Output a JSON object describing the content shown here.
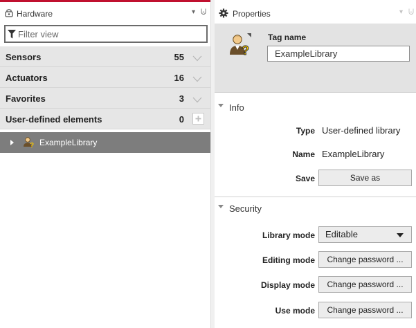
{
  "hardware_panel": {
    "title": "Hardware",
    "dropdown_glyph": "▾",
    "pin_glyph": "⨄",
    "filter": {
      "placeholder": "Filter view",
      "icon": "filter-icon"
    },
    "groups": [
      {
        "label": "Sensors",
        "count": "55",
        "control": "chevron-down-icon"
      },
      {
        "label": "Actuators",
        "count": "16",
        "control": "chevron-down-icon"
      },
      {
        "label": "Favorites",
        "count": "3",
        "control": "chevron-down-icon"
      },
      {
        "label": "User-defined elements",
        "count": "0",
        "control": "plus-icon"
      }
    ],
    "selected_item": {
      "label": "ExampleLibrary",
      "icon": "user-library-icon"
    }
  },
  "properties_panel": {
    "title": "Properties",
    "dropdown_glyph": "▾",
    "pin_glyph": "⨄",
    "tag_name": {
      "label": "Tag name",
      "value": "ExampleLibrary"
    },
    "info": {
      "title": "Info",
      "type_label": "Type",
      "type_value": "User-defined library",
      "name_label": "Name",
      "name_value": "ExampleLibrary",
      "save_label": "Save",
      "save_button": "Save as"
    },
    "security": {
      "title": "Security",
      "library_mode_label": "Library mode",
      "library_mode_value": "Editable",
      "editing_mode_label": "Editing mode",
      "editing_mode_button": "Change password ...",
      "display_mode_label": "Display mode",
      "display_mode_button": "Change password ...",
      "use_mode_label": "Use mode",
      "use_mode_button": "Change password ..."
    }
  },
  "colors": {
    "accent_top_line": "#c0102f",
    "group_background": "#e6e6e6",
    "selected_row": "#7d7d7d",
    "tag_box_background": "#e3e3e3"
  }
}
